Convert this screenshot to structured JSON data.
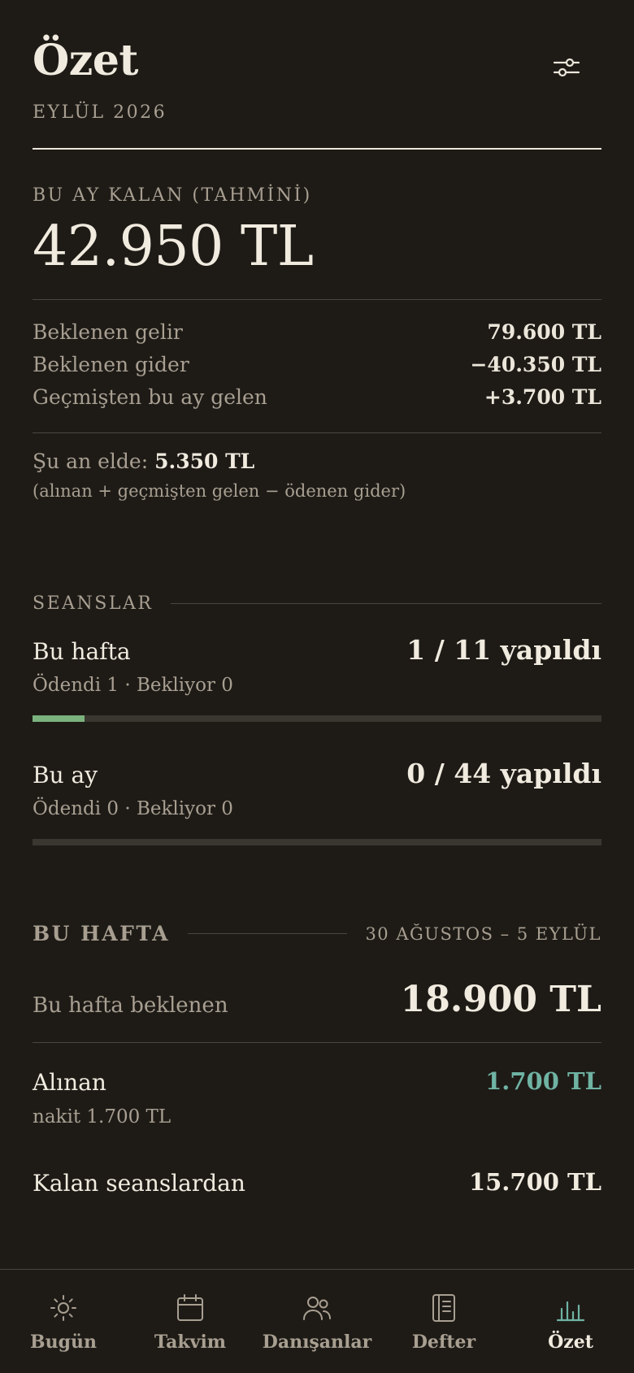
{
  "header": {
    "title": "Özet",
    "subtitle": "EYLÜL 2026",
    "filter_icon": "sliders-icon"
  },
  "remaining": {
    "label": "BU AY KALAN (TAHMİNİ)",
    "amount": "42.950 TL"
  },
  "breakdown": [
    {
      "label": "Beklenen gelir",
      "value": "79.600 TL"
    },
    {
      "label": "Beklenen gider",
      "value": "−40.350 TL"
    },
    {
      "label": "Geçmişten bu ay gelen",
      "value": "+3.700 TL"
    }
  ],
  "on_hand": {
    "label": "Şu an elde:",
    "value": "5.350 TL",
    "note": "(alınan + geçmişten gelen − ödenen gider)"
  },
  "sessions": {
    "heading": "SEANSLAR",
    "week": {
      "label": "Bu hafta",
      "count": "1 / 11 yapıldı",
      "sub": "Ödendi 1 · Bekliyor 0",
      "progress": 0.0909,
      "bar_color": "#7bb27d"
    },
    "month": {
      "label": "Bu ay",
      "count": "0 / 44 yapıldı",
      "sub": "Ödendi 0 · Bekliyor 0",
      "progress": 0
    }
  },
  "this_week": {
    "heading": "BU HAFTA",
    "range": "30 AĞUSTOS – 5 EYLÜL",
    "expected_label": "Bu hafta beklenen",
    "expected_amount": "18.900 TL",
    "received_label": "Alınan",
    "received_amount": "1.700 TL",
    "received_sub": "nakit 1.700 TL",
    "received_color": "#6fb3a3",
    "from_remaining_label": "Kalan seanslardan",
    "from_remaining_amount": "15.700 TL"
  },
  "nav": [
    {
      "label": "Bugün",
      "icon": "sun-icon",
      "active": false
    },
    {
      "label": "Takvim",
      "icon": "calendar-icon",
      "active": false
    },
    {
      "label": "Danışanlar",
      "icon": "people-icon",
      "active": false
    },
    {
      "label": "Defter",
      "icon": "notebook-icon",
      "active": false
    },
    {
      "label": "Özet",
      "icon": "bar-chart-icon",
      "active": true
    }
  ],
  "colors": {
    "background": "#1e1b17",
    "text": "#f1ebdf",
    "muted": "#a89f91",
    "accent_teal": "#6fb3a3",
    "progress_green": "#7bb27d"
  }
}
